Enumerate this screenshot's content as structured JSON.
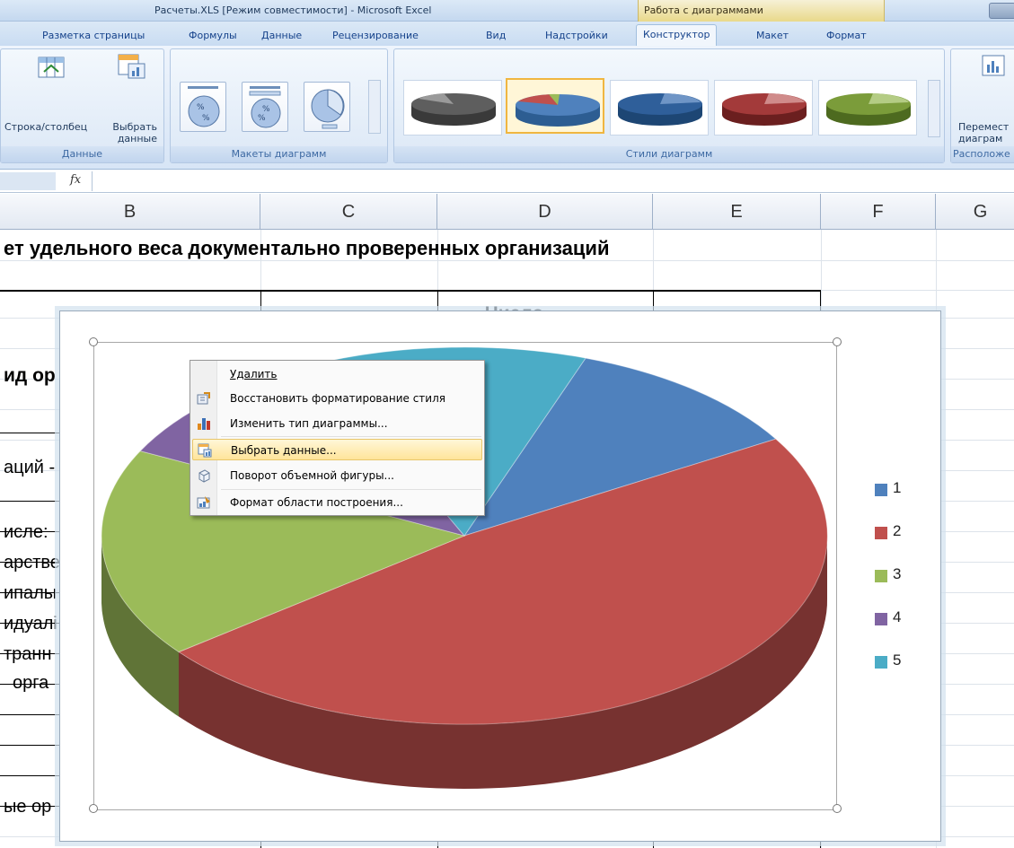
{
  "window": {
    "title": "Расчеты.XLS [Режим совместимости] - Microsoft Excel",
    "context_title": "Работа с диаграммами"
  },
  "tabs": [
    {
      "label": "Разметка страницы"
    },
    {
      "label": "Формулы"
    },
    {
      "label": "Данные"
    },
    {
      "label": "Рецензирование"
    },
    {
      "label": "Вид"
    },
    {
      "label": "Надстройки"
    },
    {
      "label": "Конструктор",
      "active": true
    },
    {
      "label": "Макет"
    },
    {
      "label": "Формат"
    }
  ],
  "ribbon": {
    "data_group": {
      "label": "Данные",
      "row_col": "Строка/столбец",
      "select_data_1": "Выбрать",
      "select_data_2": "данные"
    },
    "layouts_group": {
      "label": "Макеты диаграмм"
    },
    "styles_group": {
      "label": "Стили диаграмм"
    },
    "location_group": {
      "label": "Расположе",
      "move_1": "Перемест",
      "move_2": "диаграм"
    }
  },
  "formula_bar": {
    "fx": "fx"
  },
  "columns": [
    "B",
    "C",
    "D",
    "E",
    "F",
    "G"
  ],
  "sheet": {
    "title_row": "ет удельного веса документально проверенных организаций",
    "header_partial": "Число",
    "left_cells": [
      "ид ор",
      "аций -",
      "исле:",
      "арстве",
      "ипалы",
      "идуалі",
      "транн",
      "орга",
      "ые ор"
    ]
  },
  "chart": {
    "legend": [
      "1",
      "2",
      "3",
      "4",
      "5"
    ]
  },
  "chart_data": {
    "type": "pie",
    "categories": [
      "1",
      "2",
      "3",
      "4",
      "5"
    ],
    "values": [
      11,
      48,
      18,
      11,
      12
    ],
    "colors": [
      "#4f81bd",
      "#c0504d",
      "#9bbb59",
      "#8064a2",
      "#4bacc6"
    ],
    "legend_position": "right",
    "three_d": true
  },
  "context_menu": {
    "items": [
      {
        "label": "Удалить",
        "icon": "none-icon"
      },
      {
        "label": "Восстановить форматирование стиля",
        "icon": "reset-style-icon"
      },
      {
        "label": "Изменить тип диаграммы...",
        "icon": "chart-type-icon"
      },
      {
        "label": "Выбрать данные...",
        "icon": "select-data-icon",
        "highlighted": true
      },
      {
        "label": "Поворот объемной фигуры...",
        "icon": "rotate-3d-icon"
      },
      {
        "label": "Формат области построения...",
        "icon": "format-area-icon"
      }
    ]
  }
}
